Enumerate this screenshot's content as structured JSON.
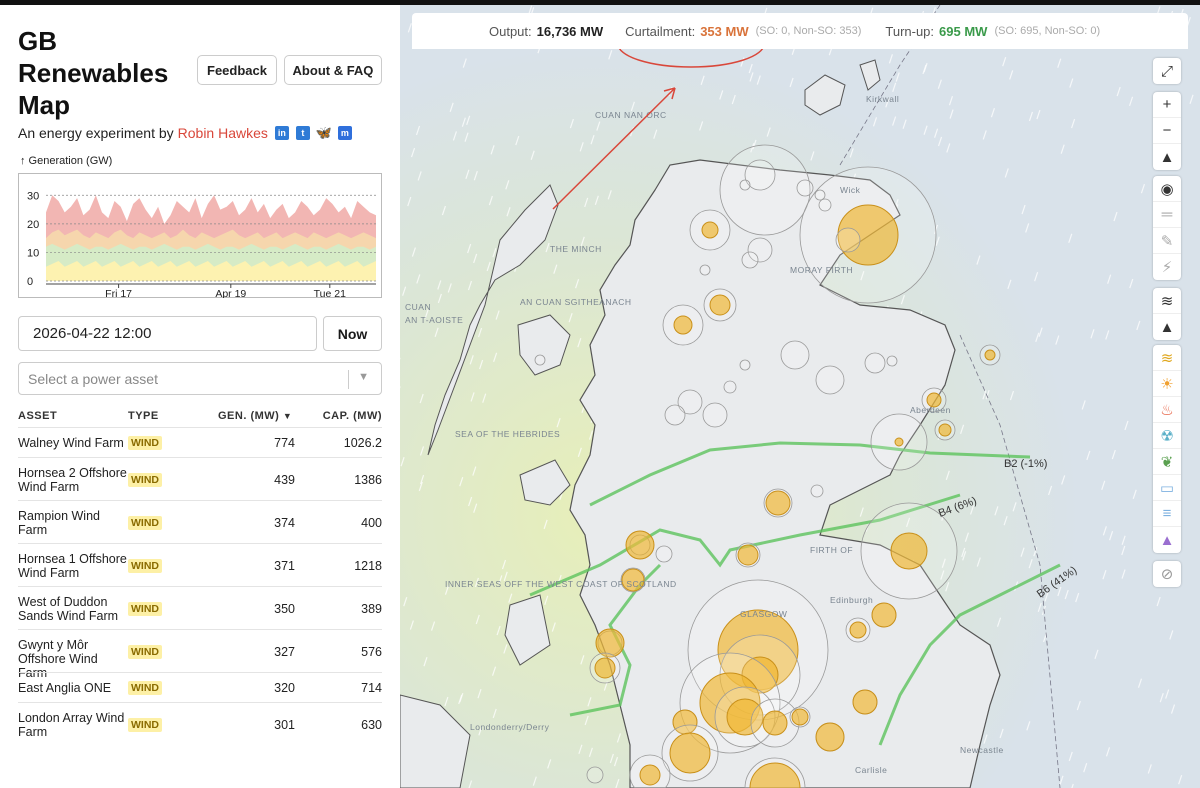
{
  "app": {
    "title": "GB Renewables Map",
    "feedback_label": "Feedback",
    "about_label": "About & FAQ",
    "subtitle_prefix": "An energy experiment by",
    "author": "Robin Hawkes"
  },
  "social_icons": [
    "linkedin-icon",
    "twitter-icon",
    "bluesky-icon",
    "mastodon-icon"
  ],
  "chart_label": "↑ Generation (GW)",
  "chart_data": {
    "type": "area",
    "ylabel": "Generation (GW)",
    "ylim": [
      0,
      35
    ],
    "yticks": [
      0,
      10,
      20,
      30
    ],
    "xticks": [
      "Fri 17",
      "Apr 19",
      "Tue 21"
    ],
    "series": [
      {
        "color": "#f2b6b3",
        "values": [
          24,
          30,
          28,
          24,
          26,
          29,
          23,
          25,
          30,
          24,
          22,
          28,
          26,
          21,
          27,
          29,
          25,
          22,
          26,
          20,
          23,
          28,
          26,
          24,
          29,
          22,
          27,
          30,
          25,
          26,
          28,
          23,
          25,
          29,
          24,
          27,
          22,
          25,
          27,
          22,
          24,
          28,
          26,
          23,
          25,
          29,
          27,
          24,
          26,
          22,
          28,
          26,
          24,
          23
        ]
      },
      {
        "color": "#f6d6ad",
        "values": [
          15,
          17,
          18,
          16,
          17,
          18,
          16,
          15,
          17,
          16,
          15,
          17,
          18,
          16,
          15,
          17,
          16,
          15,
          16,
          17,
          15,
          16,
          18,
          16,
          15,
          17,
          16,
          15,
          16,
          17,
          18,
          16,
          15,
          16,
          17,
          15,
          16,
          17,
          15,
          16,
          17,
          16,
          15,
          17,
          16,
          15,
          16,
          17,
          16,
          15,
          16,
          17,
          16,
          15
        ]
      },
      {
        "color": "#d6ebc6",
        "values": [
          12,
          13,
          12,
          11,
          12,
          13,
          12,
          11,
          12,
          12,
          11,
          12,
          13,
          12,
          11,
          12,
          12,
          11,
          12,
          13,
          12,
          11,
          12,
          12,
          11,
          12,
          13,
          12,
          11,
          12,
          12,
          11,
          12,
          13,
          12,
          11,
          12,
          12,
          11,
          12,
          13,
          12,
          11,
          12,
          12,
          11,
          12,
          13,
          12,
          11,
          12,
          12,
          11,
          12
        ]
      },
      {
        "color": "#fdf2b0",
        "values": [
          5,
          6,
          7,
          5,
          6,
          7,
          5,
          6,
          7,
          5,
          6,
          7,
          5,
          6,
          7,
          5,
          6,
          7,
          5,
          6,
          7,
          5,
          6,
          7,
          5,
          6,
          7,
          5,
          6,
          7,
          5,
          6,
          7,
          5,
          6,
          7,
          5,
          6,
          7,
          5,
          6,
          7,
          5,
          6,
          7,
          5,
          6,
          7,
          5,
          6,
          7,
          5,
          6,
          7
        ]
      }
    ]
  },
  "datetime_value": "2026-04-22 12:00",
  "now_label": "Now",
  "asset_select_placeholder": "Select a power asset",
  "table": {
    "headers": {
      "asset": "ASSET",
      "type": "TYPE",
      "gen": "GEN. (MW)",
      "cap": "CAP. (MW)"
    },
    "rows": [
      {
        "asset": "Walney Wind Farm",
        "type": "WIND",
        "gen": "774",
        "cap": "1026.2"
      },
      {
        "asset": "Hornsea 2 Offshore Wind Farm",
        "type": "WIND",
        "gen": "439",
        "cap": "1386"
      },
      {
        "asset": "Rampion Wind Farm",
        "type": "WIND",
        "gen": "374",
        "cap": "400"
      },
      {
        "asset": "Hornsea 1 Offshore Wind Farm",
        "type": "WIND",
        "gen": "371",
        "cap": "1218"
      },
      {
        "asset": "West of Duddon Sands Wind Farm",
        "type": "WIND",
        "gen": "350",
        "cap": "389"
      },
      {
        "asset": "Gwynt y Môr Offshore Wind Farm",
        "type": "WIND",
        "gen": "327",
        "cap": "576"
      },
      {
        "asset": "East Anglia ONE",
        "type": "WIND",
        "gen": "320",
        "cap": "714"
      },
      {
        "asset": "London Array Wind Farm",
        "type": "WIND",
        "gen": "301",
        "cap": "630"
      }
    ]
  },
  "status": {
    "output_label": "Output:",
    "output_value": "16,736 MW",
    "curtailment_label": "Curtailment:",
    "curtailment_value": "353 MW",
    "curtailment_sub": "(SO: 0, Non-SO: 353)",
    "turnup_label": "Turn-up:",
    "turnup_value": "695 MW",
    "turnup_sub": "(SO: 695, Non-SO: 0)"
  },
  "colors": {
    "curtailment": "#d9733a",
    "turnup": "#3a9a4a",
    "accent_red": "#d9473a",
    "wind_badge": "#fdf0a6",
    "boundary": "#5cc35c"
  },
  "map": {
    "labels": [
      "CUAN NAN ORC",
      "THE MINCH",
      "AN CUAN SGITHEANACH",
      "CUAN",
      "AN T-AOISTE",
      "SEA OF THE HEBRIDES",
      "INNER SEAS OFF THE WEST COAST OF SCOTLAND",
      "MORAY FIRTH",
      "Aberdeen",
      "FIRTH OF",
      "Edinburgh",
      "GLASGOW",
      "Londonderry/Derry",
      "Newcastle",
      "Carlisle",
      "Wick",
      "Kirkwall"
    ],
    "boundaries": [
      "B2 (-1%)",
      "B4 (6%)",
      "B6 (41%)"
    ]
  },
  "map_controls": [
    "expand-icon",
    "zoom-in-icon",
    "zoom-out-icon",
    "compass-icon",
    "locate-icon",
    "layers-icon",
    "brush-icon",
    "plug-icon",
    "wind-icon",
    "road-icon",
    "wind-filter-icon",
    "solar-icon",
    "gas-icon",
    "nuclear-icon",
    "biomass-icon",
    "interconnector-icon",
    "storage-icon",
    "other-icon",
    "hide-icon"
  ]
}
